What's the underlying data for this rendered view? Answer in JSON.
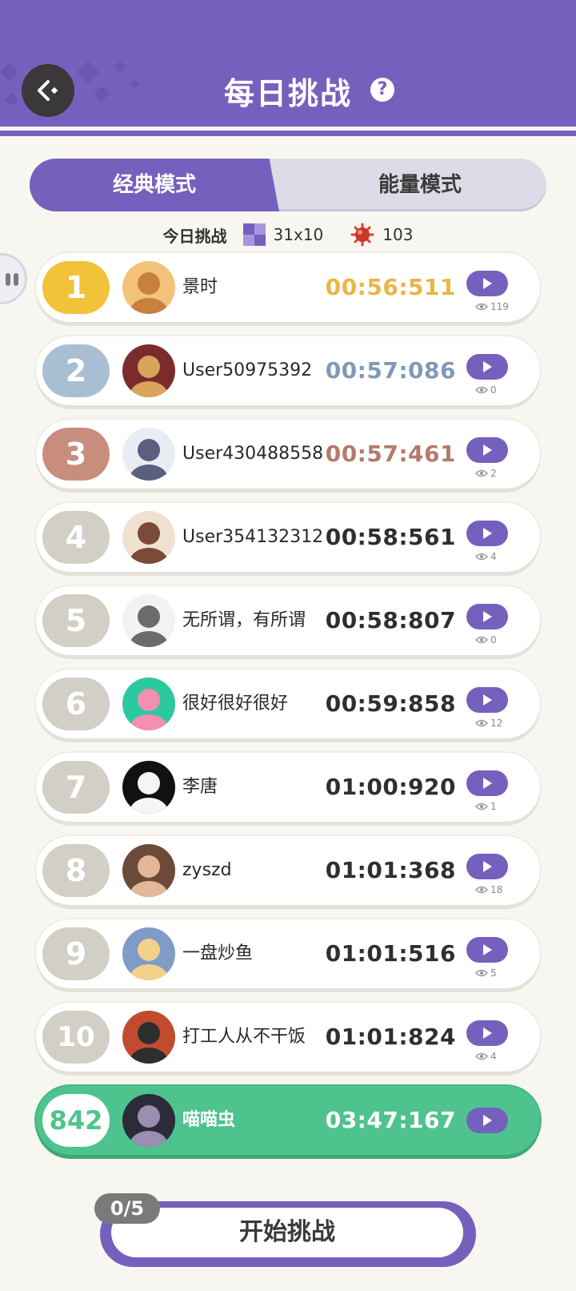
{
  "header": {
    "title": "每日挑战"
  },
  "tabs": [
    {
      "label": "经典模式",
      "active": true
    },
    {
      "label": "能量模式",
      "active": false
    }
  ],
  "stats": {
    "label": "今日挑战",
    "grid_size": "31x10",
    "mines": "103"
  },
  "leaderboard": [
    {
      "rank": "1",
      "name": "景时",
      "time": "00:56:511",
      "views": "119"
    },
    {
      "rank": "2",
      "name": "User50975392",
      "time": "00:57:086",
      "views": "0"
    },
    {
      "rank": "3",
      "name": "User430488558",
      "time": "00:57:461",
      "views": "2"
    },
    {
      "rank": "4",
      "name": "User354132312",
      "time": "00:58:561",
      "views": "4"
    },
    {
      "rank": "5",
      "name": "无所谓，有所谓",
      "time": "00:58:807",
      "views": "0"
    },
    {
      "rank": "6",
      "name": "很好很好很好",
      "time": "00:59:858",
      "views": "12"
    },
    {
      "rank": "7",
      "name": "李唐",
      "time": "01:00:920",
      "views": "1"
    },
    {
      "rank": "8",
      "name": "zyszd",
      "time": "01:01:368",
      "views": "18"
    },
    {
      "rank": "9",
      "name": "一盘炒鱼",
      "time": "01:01:516",
      "views": "5"
    },
    {
      "rank": "10",
      "name": "打工人从不干饭",
      "time": "01:01:824",
      "views": "4"
    }
  ],
  "my_entry": {
    "rank": "842",
    "name": "喵喵虫",
    "time": "03:47:167"
  },
  "start": {
    "attempts": "0/5",
    "label": "开始挑战"
  },
  "colors": {
    "accent": "#7660bd",
    "gold": "#f2c23a",
    "silver": "#a9bed2",
    "bronze": "#c98d7e",
    "rank_default": "#d2cfc6",
    "self": "#4fc38e"
  }
}
